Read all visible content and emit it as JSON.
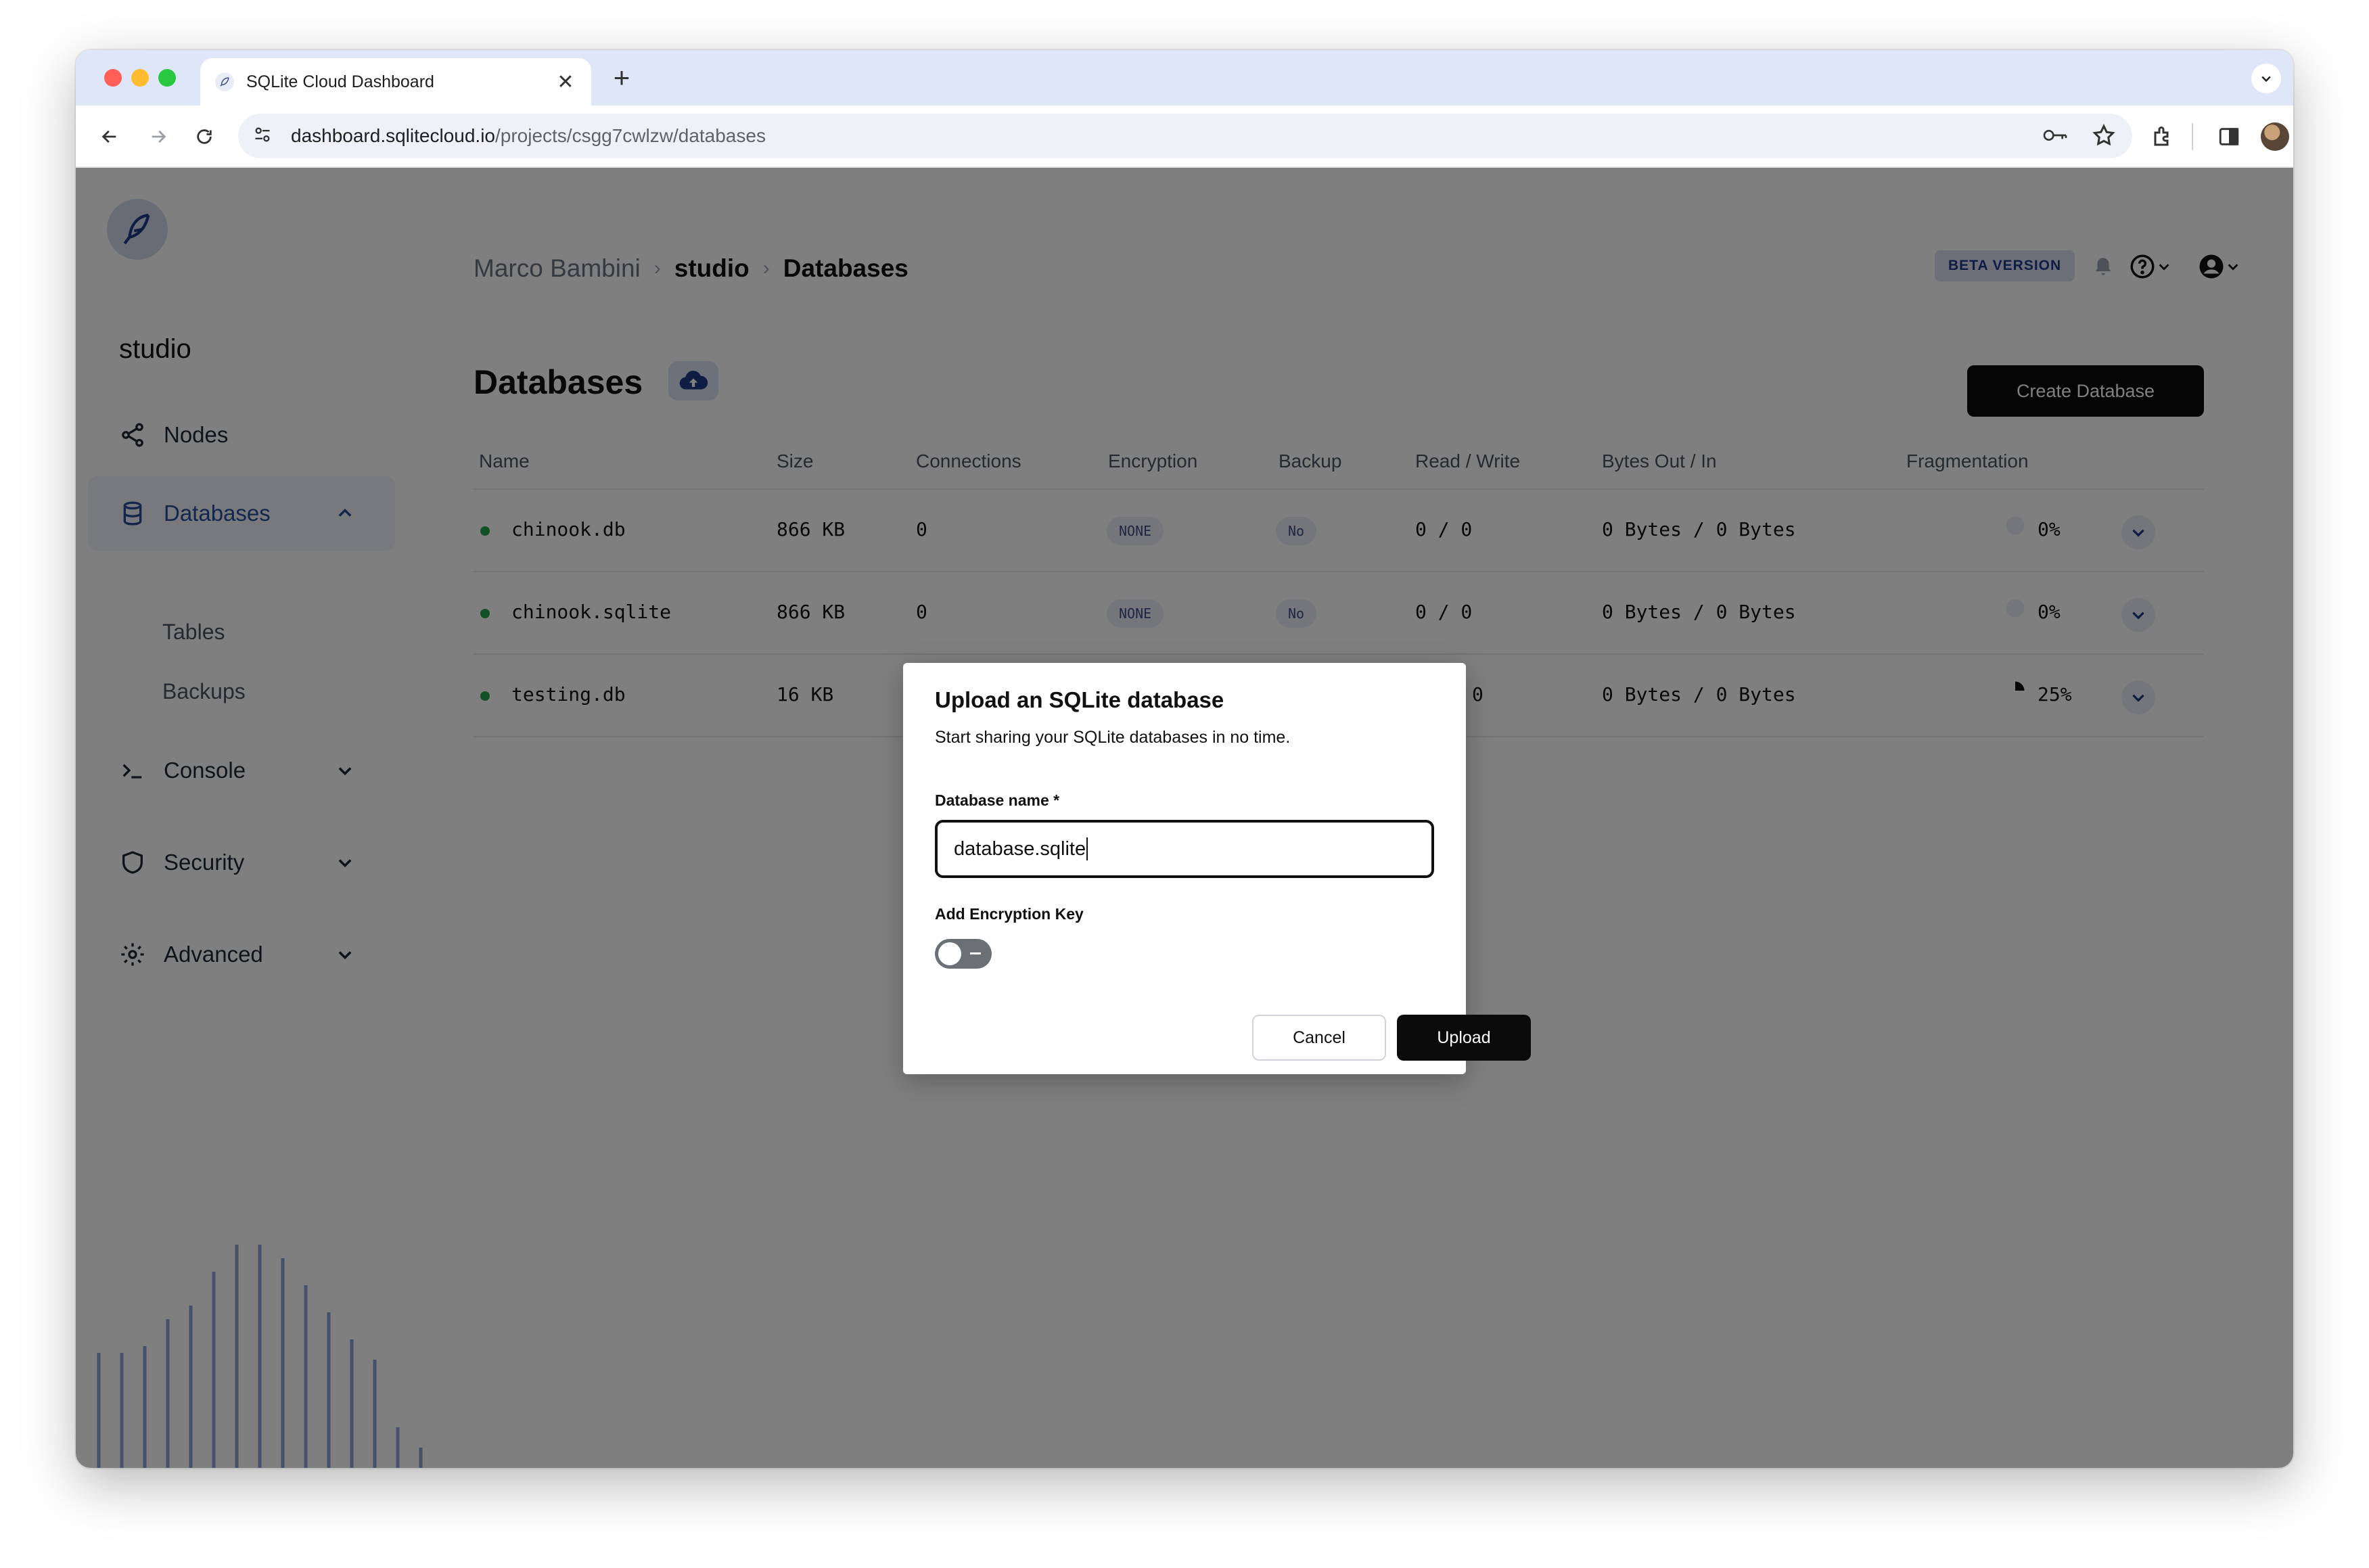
{
  "browser": {
    "tab_title": "SQLite Cloud Dashboard",
    "new_tab": "+",
    "tab_close": "✕",
    "url_host": "dashboard.sqlitecloud.io",
    "url_path": "/projects/csgg7cwlzw/databases"
  },
  "sidebar": {
    "project": "studio",
    "items": [
      {
        "label": "Nodes",
        "icon": "share-nodes-icon"
      },
      {
        "label": "Databases",
        "icon": "database-icon",
        "active": true
      },
      {
        "label": "Console",
        "icon": "terminal-icon"
      },
      {
        "label": "Security",
        "icon": "shield-icon"
      },
      {
        "label": "Advanced",
        "icon": "gear-icon"
      }
    ],
    "sub_items": [
      "Tables",
      "Backups"
    ]
  },
  "header": {
    "breadcrumb": [
      "Marco Bambini",
      "studio",
      "Databases"
    ],
    "beta_badge": "BETA VERSION"
  },
  "main": {
    "title": "Databases",
    "create_button": "Create Database",
    "columns": [
      "Name",
      "Size",
      "Connections",
      "Encryption",
      "Backup",
      "Read / Write",
      "Bytes Out / In",
      "Fragmentation"
    ],
    "rows": [
      {
        "name": "chinook.db",
        "size": "866 KB",
        "connections": "0",
        "encryption": "NONE",
        "backup": "No",
        "read_write": "0 / 0",
        "bytes": "0 Bytes / 0 Bytes",
        "fragmentation": "0%",
        "fragmentation_value": 0
      },
      {
        "name": "chinook.sqlite",
        "size": "866 KB",
        "connections": "0",
        "encryption": "NONE",
        "backup": "No",
        "read_write": "0 / 0",
        "bytes": "0 Bytes / 0 Bytes",
        "fragmentation": "0%",
        "fragmentation_value": 0
      },
      {
        "name": "testing.db",
        "size": "16 KB",
        "connections": "",
        "encryption": "",
        "backup": "",
        "read_write": "0",
        "bytes": "0 Bytes / 0 Bytes",
        "fragmentation": "25%",
        "fragmentation_value": 0.25
      }
    ]
  },
  "modal": {
    "title": "Upload an SQLite database",
    "subtitle": "Start sharing your SQLite databases in no time.",
    "name_label": "Database name *",
    "name_value": "database.sqlite",
    "encryption_label": "Add Encryption Key",
    "encryption_enabled": false,
    "cancel": "Cancel",
    "upload": "Upload"
  },
  "colors": {
    "accent": "#2b4c9b",
    "status_online": "#22a34a",
    "primary_button": "#0b0b0b"
  }
}
